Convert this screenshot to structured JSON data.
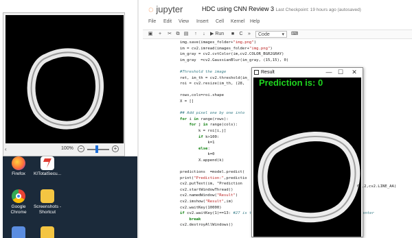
{
  "viewer": {
    "zoom": "100%",
    "scroll_left": "‹"
  },
  "desktop": {
    "icons": [
      {
        "label": "Firefox",
        "icon": "firefox-icon",
        "color": "#ff7139"
      },
      {
        "label": "KITotalSecu...",
        "icon": "ki-total-security-icon",
        "color": "#2a2a2a"
      },
      {
        "label": "Google Chrome",
        "icon": "chrome-icon",
        "color": "#4285f4"
      },
      {
        "label": "Screenshots - Shortcut",
        "icon": "folder-shortcut-icon",
        "color": "#f4c542"
      }
    ]
  },
  "jupyter": {
    "logo": "jupyter",
    "notebook_title": "HDC using CNN Review 3",
    "checkpoint": "Last Checkpoint: 19 hours ago  (autosaved)",
    "menu": [
      "File",
      "Edit",
      "View",
      "Insert",
      "Cell",
      "Kernel",
      "Help"
    ],
    "toolbar": {
      "save_icon": "save-icon",
      "add_icon": "plus-icon",
      "cut_icon": "cut-icon",
      "copy_icon": "copy-icon",
      "paste_icon": "paste-icon",
      "up_icon": "arrow-up-icon",
      "down_icon": "arrow-down-icon",
      "run_label": "▶ Run",
      "stop_icon": "stop-icon",
      "restart_icon": "restart-icon",
      "fastforward_icon": "fast-forward-icon",
      "cell_type": "Code",
      "keyboard_icon": "keyboard-icon"
    },
    "code_lines": [
      "img.save(images_folder+\"img.png\")",
      "im = cv2.imread(images_folder+\"img.png\")",
      "im_gray = cv2.cvtColor(im,cv2.COLOR_BGR2GRAY)",
      "im_gray  =cv2.GaussianBlur(im_gray, (15,15), 0)",
      "",
      "#Threshold the image",
      "ret, im_th = cv2.threshold(im_",
      "roi = cv2.resize(im_th, (28,",
      "",
      "rows,cols=roi.shape",
      "X = []",
      "",
      "## Add pixel one by one into",
      "for i in range(rows):",
      "    for j in range(cols):",
      "        k = roi[i,j]",
      "        if k>100:",
      "            k=1",
      "        else:",
      "            k=0",
      "        X.append(k)",
      "",
      "predictions  =model.predict(",
      "print(\"Prediction:\",predictio",
      "cv2.putText(im, \"Prediction",
      "cv2.startWindowThread()",
      "cv2.namedWindow(\"Result\")",
      "cv2.imshow(\"Result\",im)",
      "cv2.waitKey(10000)",
      "if cv2.waitKey(1)==13: #27 is the ascii value of esc, 13 is the ascii value of enter",
      "    break",
      "cv2.destroyAllWindows()"
    ],
    "code_overflow": "0),2,cv2.LINE_AA)"
  },
  "result_window": {
    "title": "Result",
    "minimize": "—",
    "maximize": "☐",
    "close": "✕",
    "prediction_text": "Prediction is: 0",
    "prediction_color": "#1fd51f"
  }
}
